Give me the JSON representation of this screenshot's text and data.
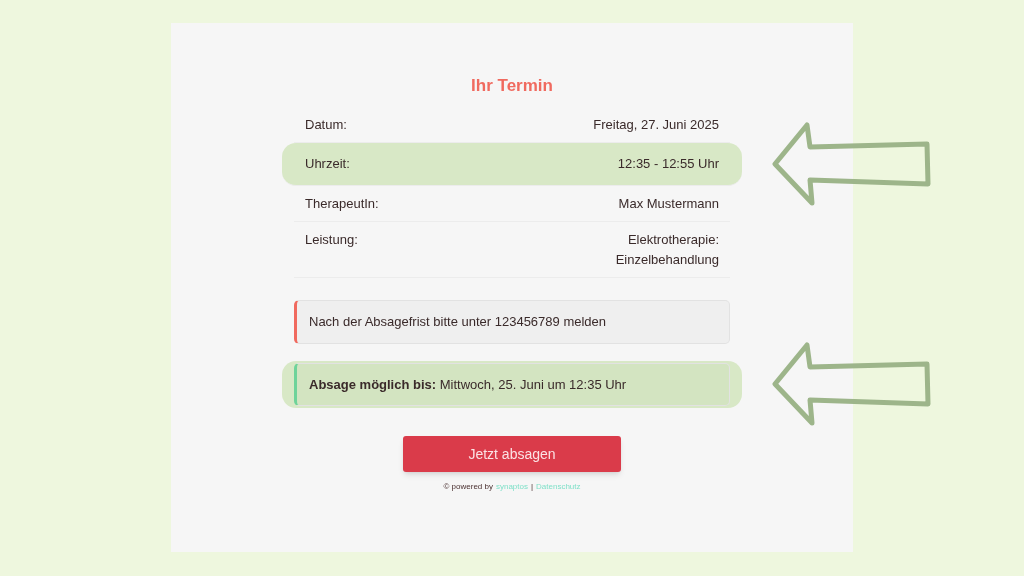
{
  "title": "Ihr Termin",
  "details": [
    {
      "label": "Datum:",
      "value": "Freitag, 27. Juni 2025",
      "highlighted": false
    },
    {
      "label": "Uhrzeit:",
      "value": "12:35 - 12:55 Uhr",
      "highlighted": true
    },
    {
      "label": "TherapeutIn:",
      "value": "Max Mustermann",
      "highlighted": false
    },
    {
      "label": "Leistung:",
      "value": "Elektrotherapie: Einzelbehandlung",
      "highlighted": false
    }
  ],
  "notices": [
    {
      "kind": "warning",
      "text": "Nach der Absagefrist bitte unter 123456789 melden",
      "highlighted": false
    },
    {
      "kind": "success",
      "text": "**Absage möglich bis:** Mittwoch, 25. Juni um 12:35 Uhr",
      "highlighted": true
    }
  ],
  "button": "Jetzt absagen",
  "footer": {
    "prefix": "© powered by",
    "brand_link": "synaptos",
    "separator": "|",
    "privacy_link": "Datenschutz"
  }
}
